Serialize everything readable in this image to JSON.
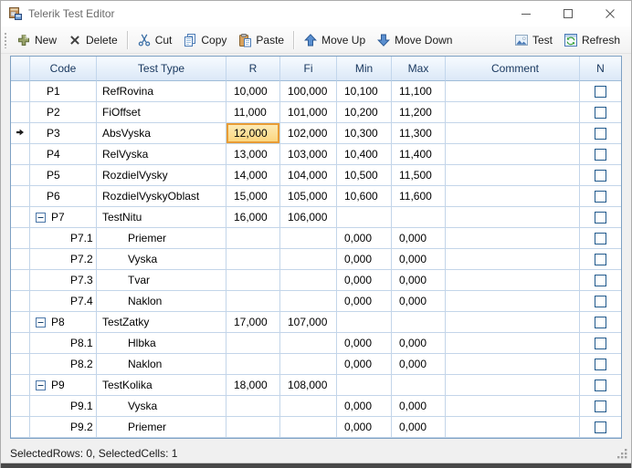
{
  "window": {
    "title": "Telerik Test Editor",
    "status_text": "SelectedRows: 0, SelectedCells: 1"
  },
  "toolbar": {
    "left_items": [
      {
        "label": "New",
        "icon": "new-plus-icon"
      },
      {
        "label": "Delete",
        "icon": "delete-x-icon"
      },
      {
        "separator": true
      },
      {
        "label": "Cut",
        "icon": "cut-scissors-icon"
      },
      {
        "label": "Copy",
        "icon": "copy-pages-icon"
      },
      {
        "label": "Paste",
        "icon": "paste-clipboard-icon"
      },
      {
        "separator": true
      },
      {
        "label": "Move Up",
        "icon": "move-up-arrow-icon"
      },
      {
        "label": "Move Down",
        "icon": "move-down-arrow-icon"
      }
    ],
    "right_items": [
      {
        "label": "Test",
        "icon": "test-picture-icon"
      },
      {
        "label": "Refresh",
        "icon": "refresh-icon"
      }
    ]
  },
  "grid": {
    "columns": [
      {
        "key": "indicator",
        "label": ""
      },
      {
        "key": "code",
        "label": "Code"
      },
      {
        "key": "type",
        "label": "Test Type"
      },
      {
        "key": "r",
        "label": "R"
      },
      {
        "key": "fi",
        "label": "Fi"
      },
      {
        "key": "min",
        "label": "Min"
      },
      {
        "key": "max",
        "label": "Max"
      },
      {
        "key": "comment",
        "label": "Comment"
      },
      {
        "key": "n",
        "label": "N"
      }
    ],
    "rows": [
      {
        "code": "P1",
        "level": "top",
        "type": "RefRovina",
        "r": "10,000",
        "fi": "100,000",
        "min": "10,100",
        "max": "11,100",
        "comment": "",
        "checked": false
      },
      {
        "code": "P2",
        "level": "top",
        "type": "FiOffset",
        "r": "11,000",
        "fi": "101,000",
        "min": "10,200",
        "max": "11,200",
        "comment": "",
        "checked": false
      },
      {
        "code": "P3",
        "level": "top",
        "type": "AbsVyska",
        "r": "12,000",
        "fi": "102,000",
        "min": "10,300",
        "max": "11,300",
        "comment": "",
        "checked": false,
        "current": true,
        "selected_cell": "r"
      },
      {
        "code": "P4",
        "level": "top",
        "type": "RelVyska",
        "r": "13,000",
        "fi": "103,000",
        "min": "10,400",
        "max": "11,400",
        "comment": "",
        "checked": false
      },
      {
        "code": "P5",
        "level": "top",
        "type": "RozdielVysky",
        "r": "14,000",
        "fi": "104,000",
        "min": "10,500",
        "max": "11,500",
        "comment": "",
        "checked": false
      },
      {
        "code": "P6",
        "level": "top",
        "type": "RozdielVyskyOblast",
        "r": "15,000",
        "fi": "105,000",
        "min": "10,600",
        "max": "11,600",
        "comment": "",
        "checked": false
      },
      {
        "code": "P7",
        "level": "group",
        "expanded": true,
        "type": "TestNitu",
        "r": "16,000",
        "fi": "106,000",
        "min": "",
        "max": "",
        "comment": "",
        "checked": false
      },
      {
        "code": "P7.1",
        "level": "sub",
        "type": "Priemer",
        "r": "",
        "fi": "",
        "min": "0,000",
        "max": "0,000",
        "comment": "",
        "checked": false
      },
      {
        "code": "P7.2",
        "level": "sub",
        "type": "Vyska",
        "r": "",
        "fi": "",
        "min": "0,000",
        "max": "0,000",
        "comment": "",
        "checked": false
      },
      {
        "code": "P7.3",
        "level": "sub",
        "type": "Tvar",
        "r": "",
        "fi": "",
        "min": "0,000",
        "max": "0,000",
        "comment": "",
        "checked": false
      },
      {
        "code": "P7.4",
        "level": "sub",
        "type": "Naklon",
        "r": "",
        "fi": "",
        "min": "0,000",
        "max": "0,000",
        "comment": "",
        "checked": false
      },
      {
        "code": "P8",
        "level": "group",
        "expanded": true,
        "type": "TestZatky",
        "r": "17,000",
        "fi": "107,000",
        "min": "",
        "max": "",
        "comment": "",
        "checked": false
      },
      {
        "code": "P8.1",
        "level": "sub",
        "type": "Hlbka",
        "r": "",
        "fi": "",
        "min": "0,000",
        "max": "0,000",
        "comment": "",
        "checked": false
      },
      {
        "code": "P8.2",
        "level": "sub",
        "type": "Naklon",
        "r": "",
        "fi": "",
        "min": "0,000",
        "max": "0,000",
        "comment": "",
        "checked": false
      },
      {
        "code": "P9",
        "level": "group",
        "expanded": true,
        "type": "TestKolika",
        "r": "18,000",
        "fi": "108,000",
        "min": "",
        "max": "",
        "comment": "",
        "checked": false
      },
      {
        "code": "P9.1",
        "level": "sub",
        "type": "Vyska",
        "r": "",
        "fi": "",
        "min": "0,000",
        "max": "0,000",
        "comment": "",
        "checked": false
      },
      {
        "code": "P9.2",
        "level": "sub",
        "type": "Priemer",
        "r": "",
        "fi": "",
        "min": "0,000",
        "max": "0,000",
        "comment": "",
        "checked": false
      }
    ]
  },
  "colors": {
    "selected_cell_fill": "#fbd479",
    "selected_cell_border": "#e89c35",
    "grid_line": "#c3d5e9",
    "grid_border": "#7da0c3",
    "header_text": "#17365d",
    "checkbox_border": "#20598c"
  }
}
